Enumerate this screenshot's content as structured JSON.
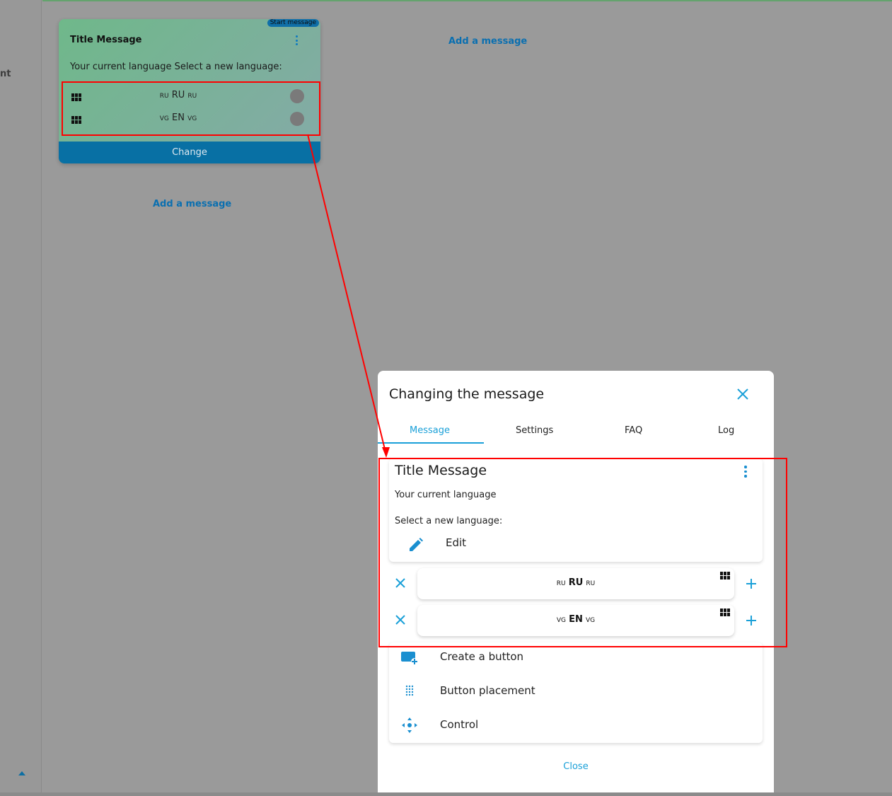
{
  "sidebar": {
    "label_fragment": "nt"
  },
  "card": {
    "badge": "Start message",
    "title": "Title Message",
    "text": "Your current language Select a new language:",
    "buttons": [
      {
        "pre": "RU",
        "main": "RU",
        "post": "RU"
      },
      {
        "pre": "VG",
        "main": "EN",
        "post": "VG"
      }
    ],
    "change_label": "Change"
  },
  "canvas": {
    "add_message_top": "Add a message",
    "add_message_bottom": "Add a message"
  },
  "modal": {
    "title": "Changing the message",
    "tabs": [
      "Message",
      "Settings",
      "FAQ",
      "Log"
    ],
    "active_tab": "Message",
    "message": {
      "title": "Title Message",
      "line1": "Your current language",
      "line2": "Select a new language:",
      "edit_label": "Edit"
    },
    "buttons": [
      {
        "pre": "RU",
        "main": "RU",
        "post": "RU"
      },
      {
        "pre": "VG",
        "main": "EN",
        "post": "VG"
      }
    ],
    "actions": [
      {
        "label": "Create a button",
        "icon": "add-button-icon"
      },
      {
        "label": "Button placement",
        "icon": "grid-dots-icon"
      },
      {
        "label": "Control",
        "icon": "move-icon"
      }
    ],
    "close_label": "Close"
  },
  "colors": {
    "accent": "#1aa0d8",
    "annotation_red": "#ff0000",
    "card_button": "#0870a4",
    "overlay": "#9a9a9a"
  }
}
